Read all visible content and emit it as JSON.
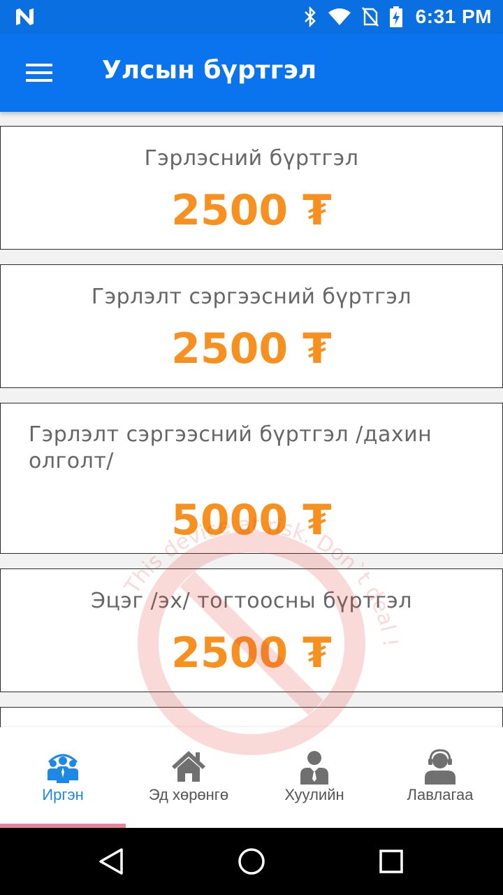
{
  "status_bar": {
    "time": "6:31 PM"
  },
  "app_bar": {
    "title": "Улсын бүртгэл"
  },
  "cards": [
    {
      "title": "Гэрлэсний бүртгэл",
      "price": "2500 ₮"
    },
    {
      "title": "Гэрлэлт сэргээсний бүртгэл",
      "price": "2500 ₮"
    },
    {
      "title_line1": "Гэрлэлт сэргээсний бүртгэл /дахин",
      "title_line2": "олголт/",
      "price": "5000 ₮"
    },
    {
      "title": "Эцэг /эх/ тогтоосны бүртгэл",
      "price": "2500 ₮"
    }
  ],
  "watermark": {
    "text": "This device at risk. Don`t deal !",
    "color": "#e53935"
  },
  "bottom_nav": {
    "items": [
      {
        "label": "Иргэн",
        "icon": "citizens-icon",
        "active": true
      },
      {
        "label": "Эд хөрөнгө",
        "icon": "house-icon",
        "active": false
      },
      {
        "label": "Хуулийн",
        "icon": "lawyer-icon",
        "active": false
      },
      {
        "label": "Лавлагаа",
        "icon": "support-agent-icon",
        "active": false
      }
    ],
    "active_color": "#1e88e5",
    "indicator_color": "#e8839c"
  },
  "colors": {
    "app_bar": "#0a74ee",
    "status_bar": "#0a6fe0",
    "price": "#f7901e"
  }
}
